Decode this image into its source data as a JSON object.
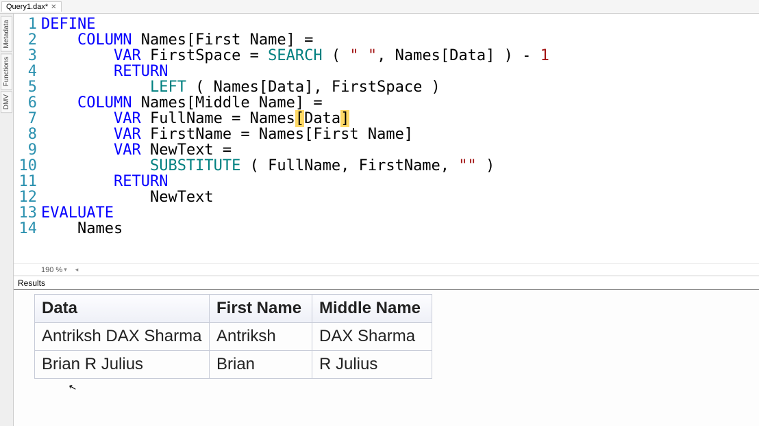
{
  "tab": {
    "title": "Query1.dax*"
  },
  "side_tabs": [
    "Metadata",
    "Functions",
    "DMV"
  ],
  "zoom": "190 %",
  "code": {
    "lines": [
      1,
      2,
      3,
      4,
      5,
      6,
      7,
      8,
      9,
      10,
      11,
      12,
      13,
      14
    ],
    "l1": "DEFINE",
    "l2_col": "COLUMN",
    "l2_rest": " Names[First Name] =",
    "l3_var": "VAR",
    "l3_mid": " FirstSpace = ",
    "l3_fn": "SEARCH",
    "l3_open": " ( ",
    "l3_str": "\" \"",
    "l3_args": ", Names[Data] ) - ",
    "l3_num": "1",
    "l4_ret": "RETURN",
    "l5_fn": "LEFT",
    "l5_rest": " ( Names[Data], FirstSpace )",
    "l6_col": "COLUMN",
    "l6_rest": " Names[Middle Name] =",
    "l7_var": "VAR",
    "l7_mid": " FullName = Names",
    "l7_b1": "[",
    "l7_inner": "Data",
    "l7_b2": "]",
    "l8_var": "VAR",
    "l8_rest": " FirstName = Names[First Name]",
    "l9_var": "VAR",
    "l9_rest": " NewText =",
    "l10_fn": "SUBSTITUTE",
    "l10_a": " ( FullName, FirstName, ",
    "l10_str": "\"\"",
    "l10_b": " )",
    "l11_ret": "RETURN",
    "l12": "NewText",
    "l13": "EVALUATE",
    "l14": "Names"
  },
  "results": {
    "label": "Results",
    "columns": [
      "Data",
      "First Name",
      "Middle Name"
    ],
    "rows": [
      {
        "data": "Antriksh DAX Sharma",
        "first": "Antriksh",
        "middle": "DAX Sharma"
      },
      {
        "data": "Brian R Julius",
        "first": "Brian",
        "middle": "R Julius"
      }
    ]
  }
}
